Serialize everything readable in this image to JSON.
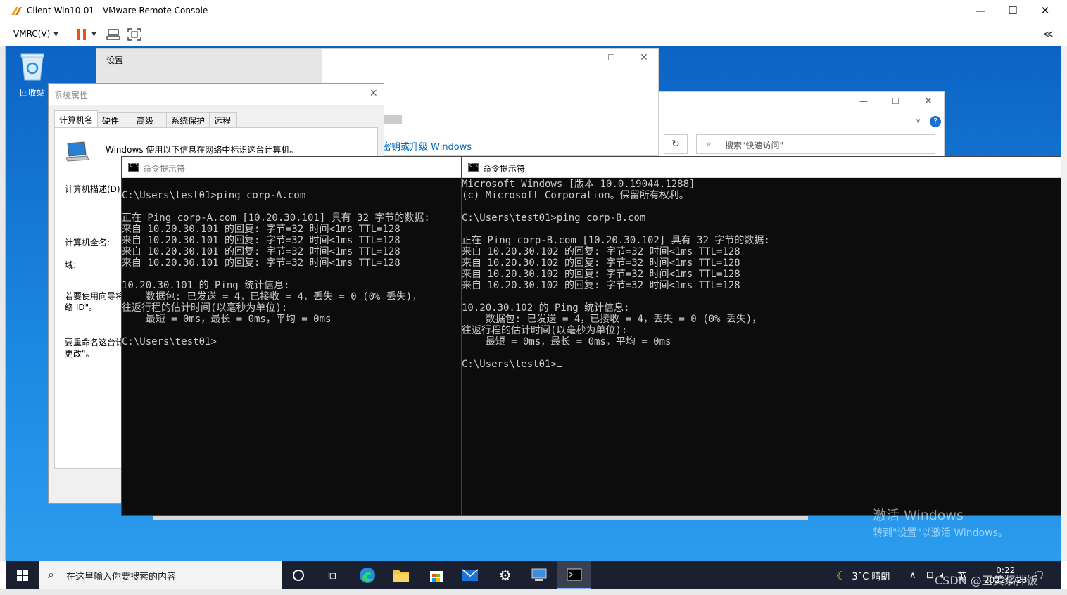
{
  "vmrc": {
    "title": "Client-Win10-01 - VMware Remote Console",
    "menu_label": "VMRC(V)",
    "minimize": "—",
    "maximize": "☐",
    "close": "✕",
    "collapse": "≪"
  },
  "desktop": {
    "recycle_bin_label": "回收站"
  },
  "settings_window": {
    "title": "设置",
    "link_text": "密钥或升级 Windows"
  },
  "explorer_window": {
    "search_placeholder": "搜索\"快速访问\""
  },
  "system_properties": {
    "title": "系统属性",
    "tabs": [
      "计算机名",
      "硬件",
      "高级",
      "系统保护",
      "远程"
    ],
    "intro": "Windows 使用以下信息在网络中标识这台计算机。",
    "desc_label": "计算机描述(D):",
    "fullname_label": "计算机全名:",
    "domain_label": "域:",
    "wizard_line1": "若要使用向导将",
    "wizard_line2": "络 ID\"。",
    "rename_line1": "要重命名这台计",
    "rename_line2": "更改\"。"
  },
  "cmd_left": {
    "title": "命令提示符",
    "lines": [
      "",
      "C:\\Users\\test01>ping corp-A.com",
      "",
      "正在 Ping corp-A.com [10.20.30.101] 具有 32 字节的数据:",
      "来自 10.20.30.101 的回复: 字节=32 时间<1ms TTL=128",
      "来自 10.20.30.101 的回复: 字节=32 时间<1ms TTL=128",
      "来自 10.20.30.101 的回复: 字节=32 时间<1ms TTL=128",
      "来自 10.20.30.101 的回复: 字节=32 时间<1ms TTL=128",
      "",
      "10.20.30.101 的 Ping 统计信息:",
      "    数据包: 已发送 = 4，已接收 = 4，丢失 = 0 (0% 丢失)，",
      "往返行程的估计时间(以毫秒为单位):",
      "    最短 = 0ms，最长 = 0ms，平均 = 0ms",
      "",
      "C:\\Users\\test01>"
    ]
  },
  "cmd_right": {
    "title": "命令提示符",
    "lines": [
      "Microsoft Windows [版本 10.0.19044.1288]",
      "(c) Microsoft Corporation。保留所有权利。",
      "",
      "C:\\Users\\test01>ping corp-B.com",
      "",
      "正在 Ping corp-B.com [10.20.30.102] 具有 32 字节的数据:",
      "来自 10.20.30.102 的回复: 字节=32 时间<1ms TTL=128",
      "来自 10.20.30.102 的回复: 字节=32 时间<1ms TTL=128",
      "来自 10.20.30.102 的回复: 字节=32 时间<1ms TTL=128",
      "来自 10.20.30.102 的回复: 字节=32 时间<1ms TTL=128",
      "",
      "10.20.30.102 的 Ping 统计信息:",
      "    数据包: 已发送 = 4，已接收 = 4，丢失 = 0 (0% 丢失)，",
      "往返行程的估计时间(以毫秒为单位):",
      "    最短 = 0ms，最长 = 0ms，平均 = 0ms",
      ""
    ],
    "prompt": "C:\\Users\\test01>"
  },
  "activation": {
    "line1": "激活 Windows",
    "line2": "转到\"设置\"以激活 Windows。"
  },
  "taskbar": {
    "search_placeholder": "在这里输入你要搜索的内容",
    "weather": "3°C 晴朗",
    "ime": "英",
    "time": "0:22",
    "date": "2022/1/23"
  },
  "watermark": "CSDN @玉黄浆拌饭"
}
